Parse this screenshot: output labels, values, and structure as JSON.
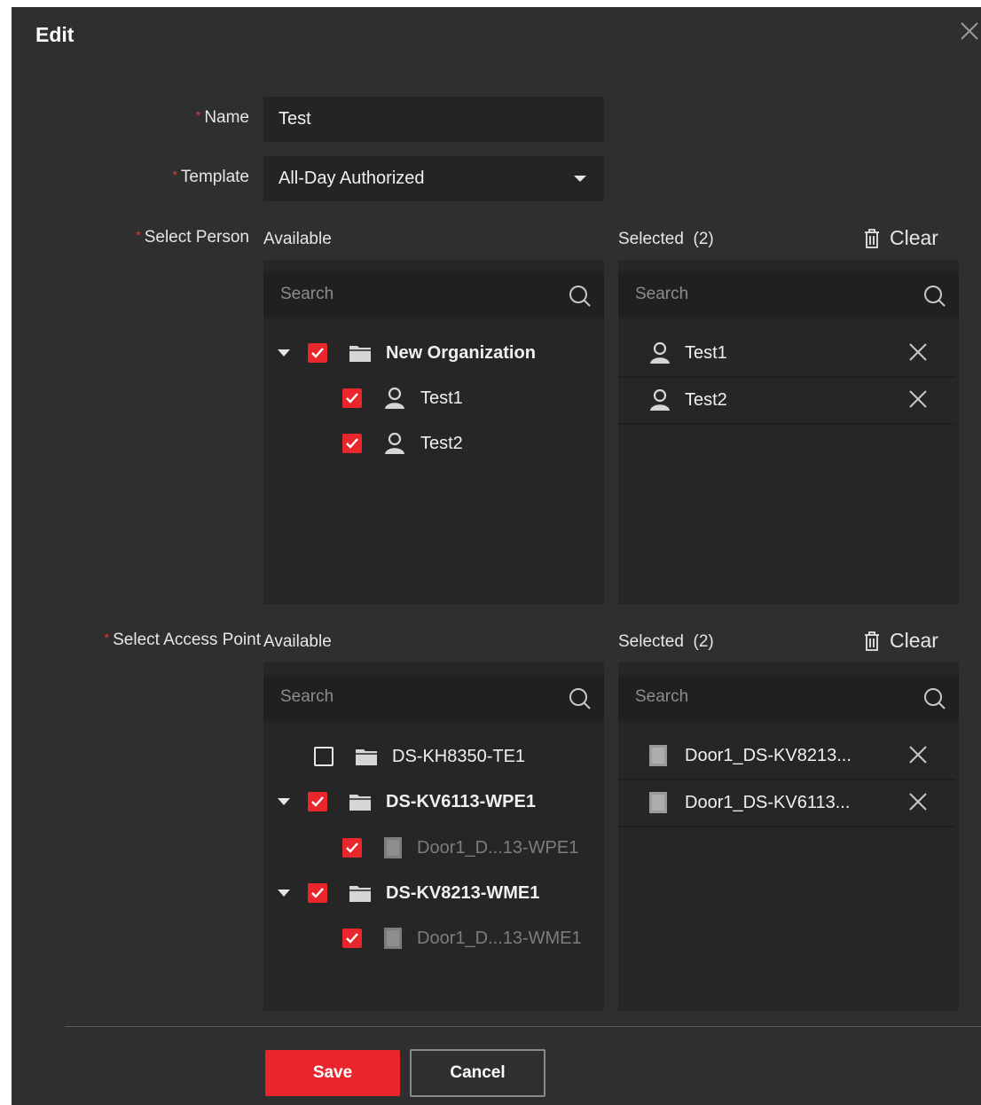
{
  "dialog": {
    "title": "Edit",
    "name_label": "Name",
    "name_value": "Test",
    "template_label": "Template",
    "template_value": "All-Day Authorized",
    "required_mark": "*"
  },
  "person": {
    "label": "Select Person",
    "available_label": "Available",
    "selected_label": "Selected",
    "selected_count": "(2)",
    "clear_label": "Clear",
    "available_search_placeholder": "Search",
    "selected_search_placeholder": "Search",
    "tree": [
      {
        "label": "New Organization",
        "checked": true,
        "type": "folder",
        "expanded": true
      },
      {
        "label": "Test1",
        "checked": true,
        "type": "person"
      },
      {
        "label": "Test2",
        "checked": true,
        "type": "person"
      }
    ],
    "selected": [
      {
        "label": "Test1",
        "icon": "person-icon"
      },
      {
        "label": "Test2",
        "icon": "person-icon"
      }
    ]
  },
  "access": {
    "label": "Select Access Point",
    "available_label": "Available",
    "selected_label": "Selected",
    "selected_count": "(2)",
    "clear_label": "Clear",
    "available_search_placeholder": "Search",
    "selected_search_placeholder": "Search",
    "tree": [
      {
        "label": "DS-KH8350-TE1",
        "checked": false,
        "type": "folder"
      },
      {
        "label": "DS-KV6113-WPE1",
        "checked": true,
        "type": "folder",
        "expanded": true
      },
      {
        "label": "Door1_D...13-WPE1",
        "checked": true,
        "type": "door"
      },
      {
        "label": "DS-KV8213-WME1",
        "checked": true,
        "type": "folder",
        "expanded": true
      },
      {
        "label": "Door1_D...13-WME1",
        "checked": true,
        "type": "door"
      }
    ],
    "selected": [
      {
        "label": "Door1_DS-KV8213...",
        "icon": "door-icon"
      },
      {
        "label": "Door1_DS-KV6113...",
        "icon": "door-icon"
      }
    ]
  },
  "footer": {
    "save_label": "Save",
    "cancel_label": "Cancel"
  },
  "colors": {
    "background": "#2f2f2f",
    "accent": "#e8262c",
    "field": "#242424"
  }
}
